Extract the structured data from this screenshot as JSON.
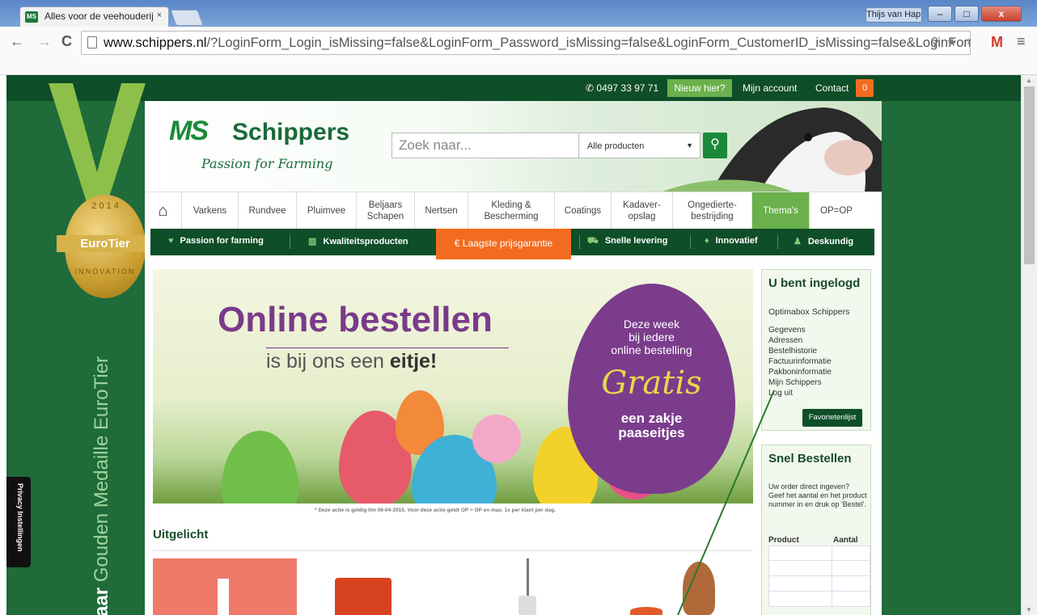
{
  "browser": {
    "tab_title": "Alles voor de veehouderij",
    "tab_favicon_text": "MS",
    "tab_close": "×",
    "user_button": "Thijs van Happ...",
    "url_domain": "www.schippers.nl",
    "url_path": "/?LoginForm_Login_isMissing=false&LoginForm_Password_isMissing=false&LoginForm_CustomerID_isMissing=false&LoginForm",
    "back_icon": "←",
    "forward_icon": "→",
    "reload_icon": "C",
    "minimize": "–",
    "maximize": "□",
    "close": "x",
    "gmail_ext": "M",
    "menu_icon": "≡"
  },
  "topbar": {
    "phone": "0497 33 97 71",
    "new_here": "Nieuw hier?",
    "account": "Mijn account",
    "contact": "Contact",
    "cart_count": "0"
  },
  "sidebar": {
    "medal_year": "2 0 1 4",
    "medal_label": "EuroTier",
    "medal_innovation": "INNOVATION",
    "vertical_text_bold": "aar",
    "vertical_text": "Gouden Medaille EuroTier",
    "privacy": "Privacy Instellingen"
  },
  "header": {
    "logo_ms": "MS",
    "logo_name": "Schippers",
    "logo_tagline": "Passion for Farming",
    "search_placeholder": "Zoek naar...",
    "search_select": "Alle producten"
  },
  "categories": [
    {
      "label": "Varkens"
    },
    {
      "label": "Rundvee"
    },
    {
      "label": "Pluimvee"
    },
    {
      "label": "Beljaars Schapen"
    },
    {
      "label": "Nertsen"
    },
    {
      "label": "Kleding & Bescherming"
    },
    {
      "label": "Coatings"
    },
    {
      "label": "Kadaver-opslag"
    },
    {
      "label": "Ongedierte-bestrijding"
    },
    {
      "label": "Thema's"
    },
    {
      "label": "OP=OP"
    }
  ],
  "usps": {
    "passion": "Passion for farming",
    "quality": "Kwaliteitsproducten",
    "lowest": "Laagste prijsgarantie",
    "delivery": "Snelle levering",
    "innovative": "Innovatief",
    "expert": "Deskundig"
  },
  "banner": {
    "title": "Online bestellen",
    "subtitle_prefix": "is bij ons een",
    "subtitle_bold": "eitje!",
    "promo_line1": "Deze week",
    "promo_line2": "bij iedere",
    "promo_line3": "online bestelling",
    "promo_gratis": "Gratis",
    "promo_line4": "een zakje",
    "promo_line5": "paaseitjes",
    "disclaimer": "* Deze actie is geldig t/m 06-04-2015. Voor deze actie geldt OP = OP en max. 1x per klant per dag."
  },
  "featured": {
    "title": "Uitgelicht"
  },
  "login_box": {
    "title": "U bent ingelogd",
    "company": "Optimabox Schippers",
    "links": [
      "Gegevens",
      "Adressen",
      "Bestelhistorie",
      "Factuurinformatie",
      "Pakboninformatie",
      "Mijn Schippers",
      "Log uit"
    ],
    "favorites_button": "Favorietenlijst"
  },
  "quick_order": {
    "title": "Snel Bestellen",
    "text": "Uw order direct ingeven? Geef het aantal en het product nummer in en druk op 'Bestel'.",
    "col_product": "Product",
    "col_amount": "Aantal"
  }
}
